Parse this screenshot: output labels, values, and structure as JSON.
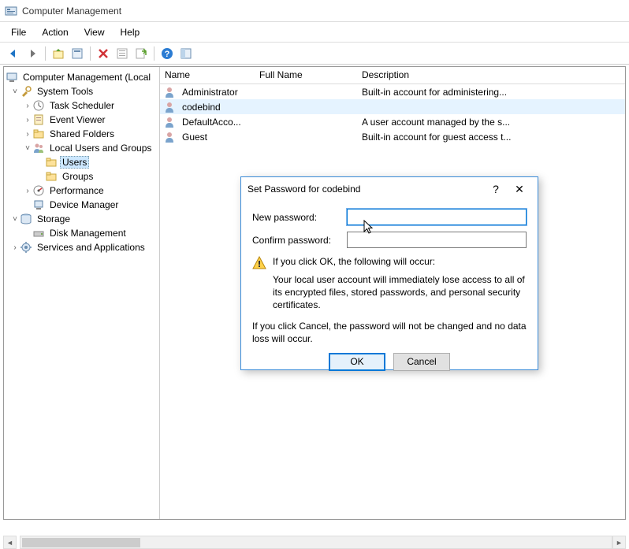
{
  "window": {
    "title": "Computer Management"
  },
  "menu": {
    "items": [
      "File",
      "Action",
      "View",
      "Help"
    ]
  },
  "tree": {
    "root": "Computer Management (Local",
    "system_tools": "System Tools",
    "task_scheduler": "Task Scheduler",
    "event_viewer": "Event Viewer",
    "shared_folders": "Shared Folders",
    "local_users": "Local Users and Groups",
    "users": "Users",
    "groups": "Groups",
    "performance": "Performance",
    "device_manager": "Device Manager",
    "storage": "Storage",
    "disk_management": "Disk Management",
    "services": "Services and Applications"
  },
  "list": {
    "columns": {
      "name": "Name",
      "full_name": "Full Name",
      "description": "Description"
    },
    "rows": [
      {
        "name": "Administrator",
        "full": "",
        "desc": "Built-in account for administering..."
      },
      {
        "name": "codebind",
        "full": "",
        "desc": ""
      },
      {
        "name": "DefaultAcco...",
        "full": "",
        "desc": "A user account managed by the s..."
      },
      {
        "name": "Guest",
        "full": "",
        "desc": "Built-in account for guest access t..."
      }
    ]
  },
  "dialog": {
    "title": "Set Password for codebind",
    "new_password_label": "New password:",
    "confirm_password_label": "Confirm password:",
    "new_password_value": "",
    "confirm_password_value": "",
    "warning_head": "If you click OK, the following will occur:",
    "warning_body": "Your local user account will immediately lose access to all of its encrypted files, stored passwords, and personal security certificates.",
    "cancel_text": "If you click Cancel, the password will not be changed and no data loss will occur.",
    "ok": "OK",
    "cancel": "Cancel",
    "help": "?",
    "close": "✕"
  }
}
